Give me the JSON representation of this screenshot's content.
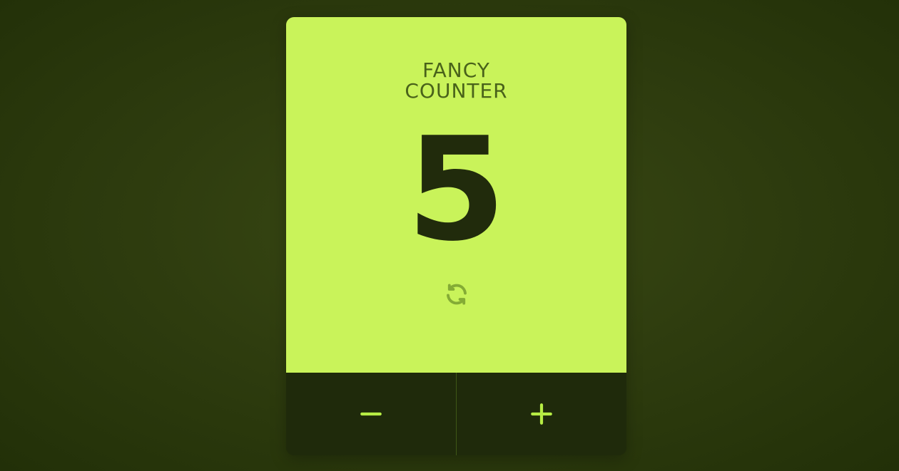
{
  "counter": {
    "title": "FANCY\nCOUNTER",
    "value": "5",
    "reset_icon": "refresh-icon",
    "decrement_icon": "minus-icon",
    "increment_icon": "plus-icon",
    "colors": {
      "display_bg": "#c9f35a",
      "title_text": "#49621a",
      "count_text": "#212b0c",
      "controls_bg": "#1f2a0b",
      "button_accent": "#b6ec44",
      "reset_icon": "#84ab35"
    }
  }
}
